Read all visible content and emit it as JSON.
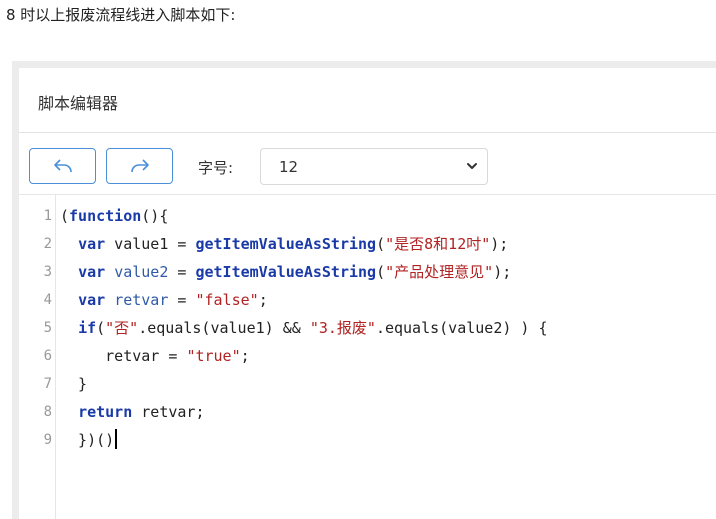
{
  "intro_text": "8 时以上报废流程线进入脚本如下:",
  "editor": {
    "title": "脚本编辑器",
    "toolbar": {
      "undo_icon": "undo-icon",
      "redo_icon": "redo-icon",
      "font_size_label": "字号:",
      "font_size_value": "12"
    },
    "lines": [
      {
        "num": "1",
        "tokens": [
          [
            "p",
            "("
          ],
          [
            "kw",
            "function"
          ],
          [
            "p",
            "(){"
          ]
        ]
      },
      {
        "num": "2",
        "tokens": [
          [
            "p",
            "  "
          ],
          [
            "kw",
            "var"
          ],
          [
            "p",
            " value1 = "
          ],
          [
            "fn",
            "getItemValueAsString"
          ],
          [
            "p",
            "("
          ],
          [
            "str",
            "\"是否8和12吋\""
          ],
          [
            "p",
            ");"
          ]
        ]
      },
      {
        "num": "3",
        "tokens": [
          [
            "p",
            "  "
          ],
          [
            "kw",
            "var"
          ],
          [
            "p",
            " "
          ],
          [
            "v2",
            "value2"
          ],
          [
            "p",
            " = "
          ],
          [
            "fn",
            "getItemValueAsString"
          ],
          [
            "p",
            "("
          ],
          [
            "str",
            "\"产品处理意见\""
          ],
          [
            "p",
            ");"
          ]
        ]
      },
      {
        "num": "4",
        "tokens": [
          [
            "p",
            "  "
          ],
          [
            "kw",
            "var"
          ],
          [
            "p",
            " "
          ],
          [
            "v2",
            "retvar"
          ],
          [
            "p",
            " = "
          ],
          [
            "str",
            "\"false\""
          ],
          [
            "p",
            ";"
          ]
        ]
      },
      {
        "num": "5",
        "tokens": [
          [
            "p",
            "  "
          ],
          [
            "kw",
            "if"
          ],
          [
            "p",
            "("
          ],
          [
            "str",
            "\"否\""
          ],
          [
            "p",
            ".equals(value1) && "
          ],
          [
            "str",
            "\"3.报废\""
          ],
          [
            "p",
            ".equals(value2) ) {"
          ]
        ]
      },
      {
        "num": "6",
        "tokens": [
          [
            "p",
            "     retvar = "
          ],
          [
            "str",
            "\"true\""
          ],
          [
            "p",
            ";"
          ]
        ]
      },
      {
        "num": "7",
        "tokens": [
          [
            "p",
            "  }"
          ]
        ]
      },
      {
        "num": "8",
        "tokens": [
          [
            "p",
            "  "
          ],
          [
            "kw",
            "return"
          ],
          [
            "p",
            " retvar;"
          ]
        ]
      },
      {
        "num": "9",
        "tokens": [
          [
            "p",
            "  })()"
          ]
        ]
      }
    ]
  }
}
